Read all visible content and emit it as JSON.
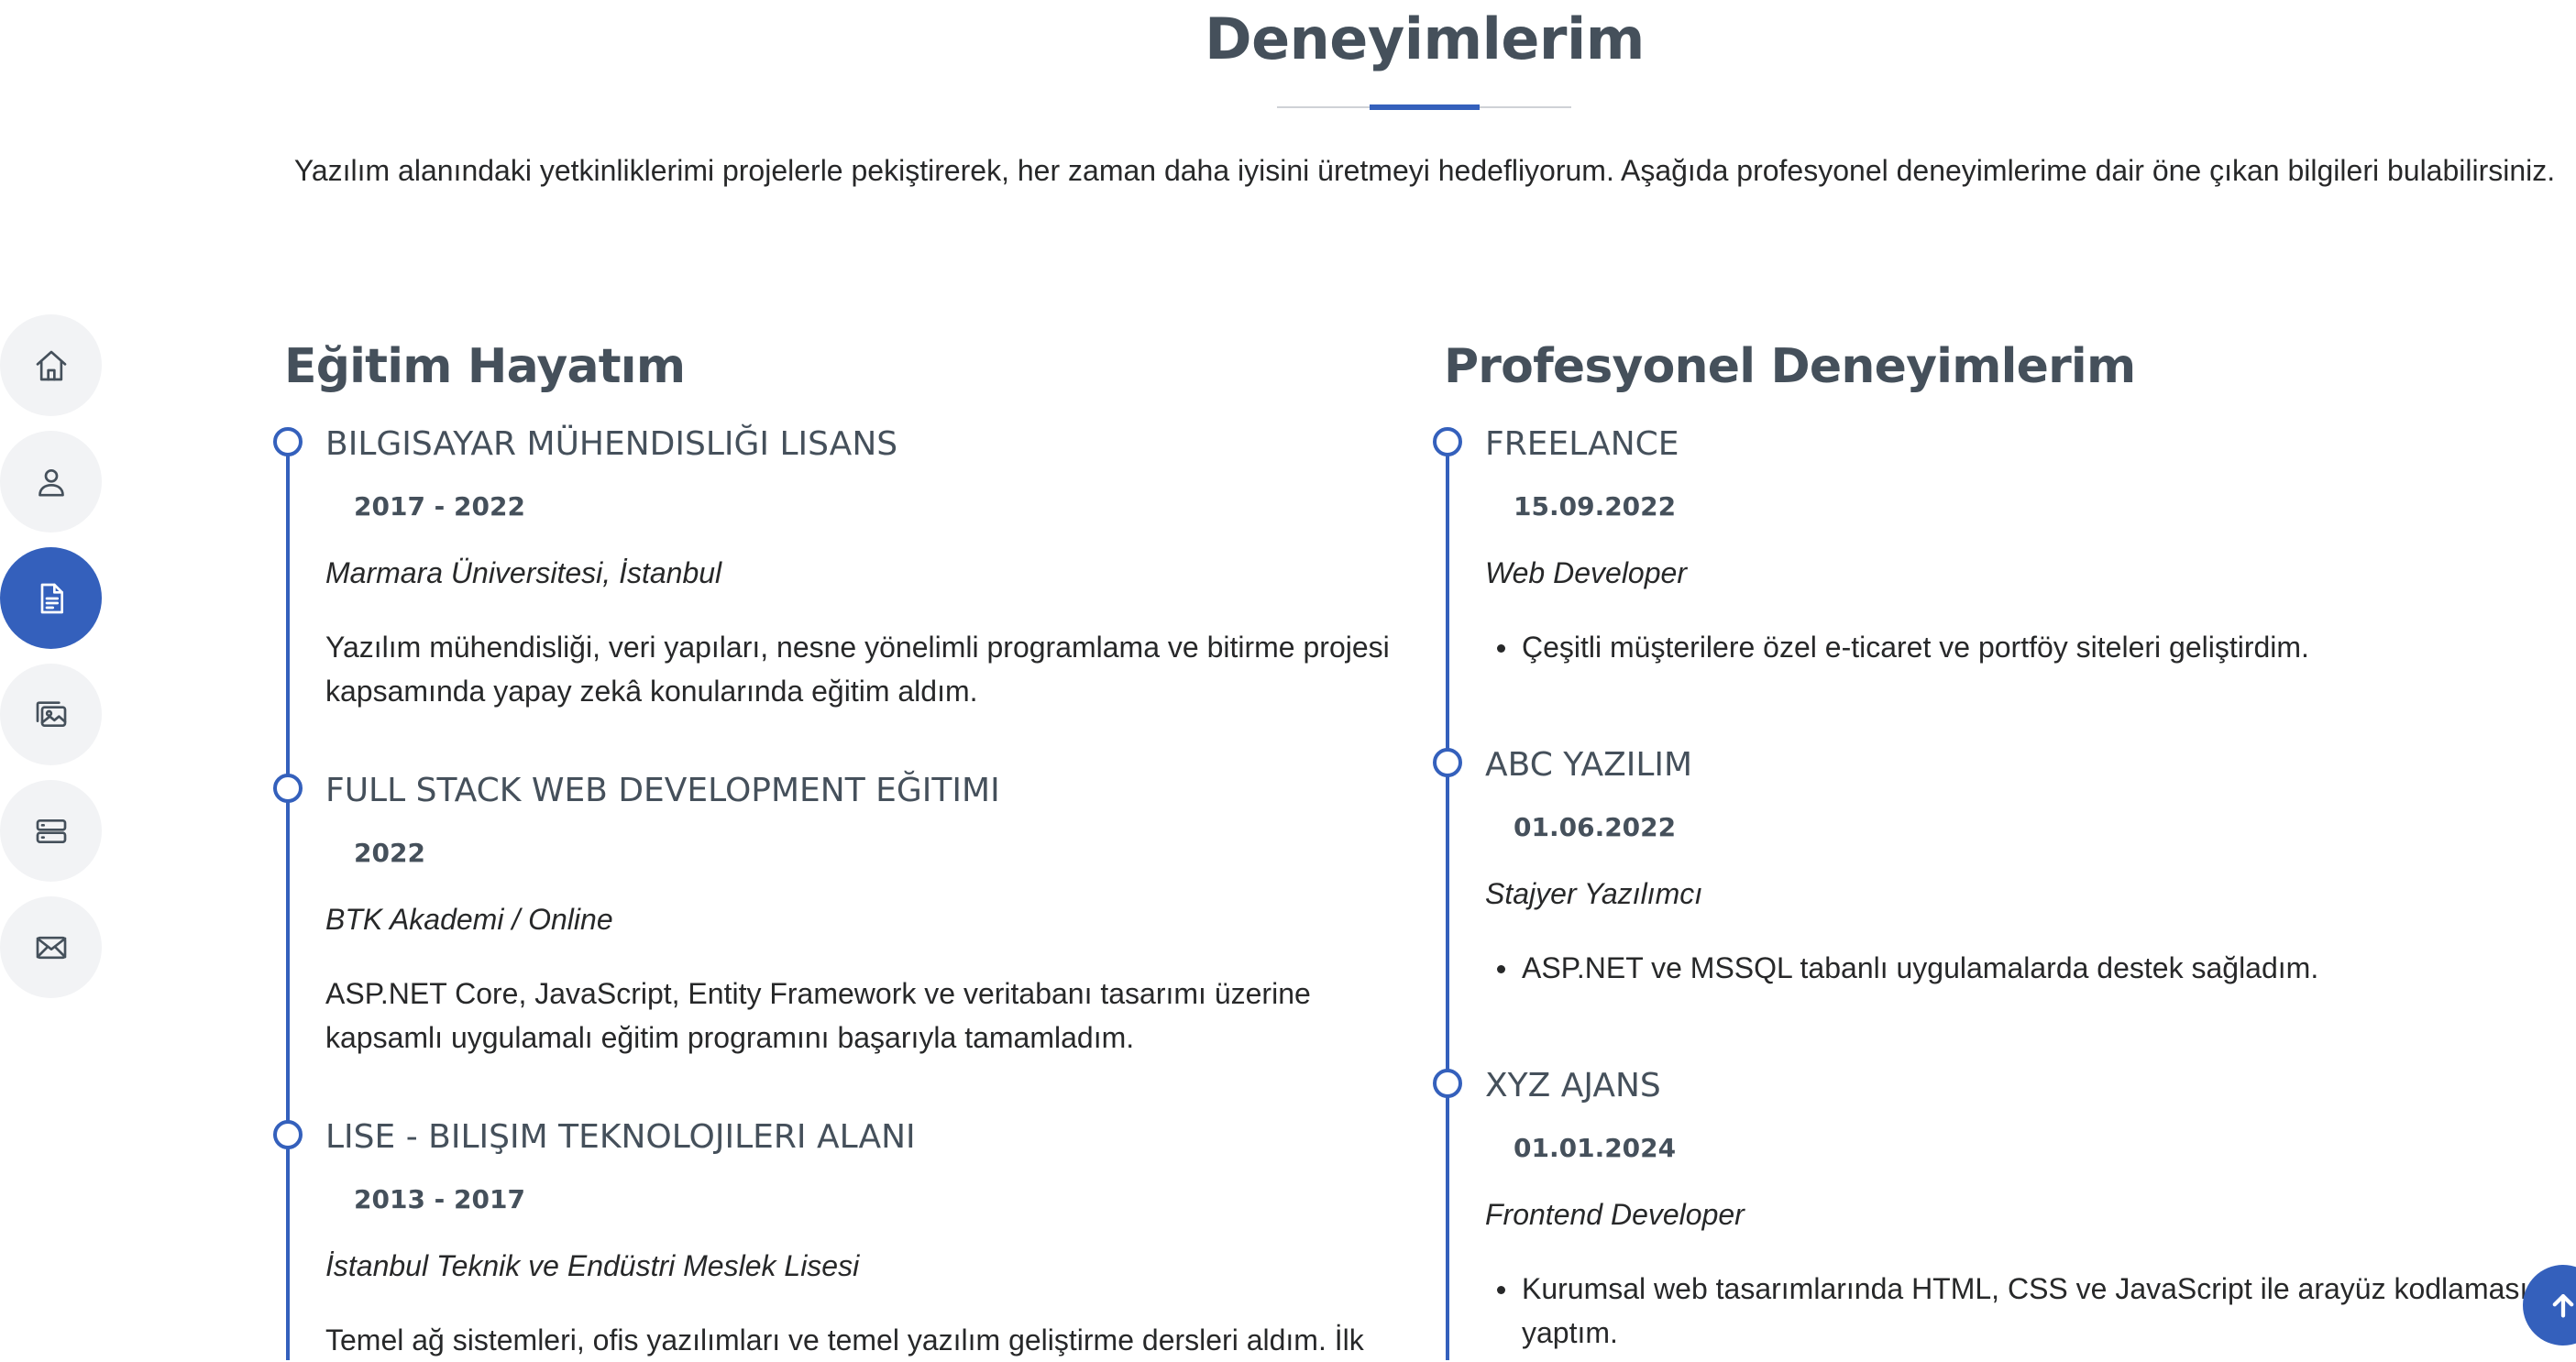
{
  "section": {
    "title": "Deneyimlerim",
    "description": "Yazılım alanındaki yetkinliklerimi projelerle pekiştirerek, her zaman daha iyisini üretmeyi hedefliyorum. Aşağıda profesyonel deneyimlerime dair öne çıkan bilgileri bulabilirsiniz."
  },
  "nav": {
    "items": [
      {
        "icon": "home-icon",
        "active": false
      },
      {
        "icon": "person-icon",
        "active": false
      },
      {
        "icon": "document-icon",
        "active": true
      },
      {
        "icon": "images-icon",
        "active": false
      },
      {
        "icon": "server-icon",
        "active": false
      },
      {
        "icon": "envelope-icon",
        "active": false
      }
    ]
  },
  "education": {
    "title": "Eğitim Hayatım",
    "items": [
      {
        "title": "Bilgisayar Mühendisliği Lisans",
        "date": "2017 - 2022",
        "place": "Marmara Üniversitesi, İstanbul",
        "text_line1": "Yazılım mühendisliği, veri yapıları, nesne yönelimli programlama ve bitirme projesi",
        "text_line2": "kapsamında yapay zekâ konularında eğitim aldım."
      },
      {
        "title": "Full Stack Web Development Eğitimi",
        "date": "2022",
        "place": "BTK Akademi / Online",
        "text_line1": "ASP.NET Core, JavaScript, Entity Framework ve veritabanı tasarımı üzerine",
        "text_line2": "kapsamlı uygulamalı eğitim programını başarıyla tamamladım."
      },
      {
        "title": "Lise - Bilişim Teknolojileri Alanı",
        "date": "2013 - 2017",
        "place": "İstanbul Teknik ve Endüstri Meslek Lisesi",
        "text_line1": "Temel ağ sistemleri, ofis yazılımları ve temel yazılım geliştirme dersleri aldım. İlk"
      }
    ]
  },
  "experience": {
    "title": "Profesyonel Deneyimlerim",
    "items": [
      {
        "title": "Freelance",
        "date": "15.09.2022",
        "role": "Web Developer",
        "bullet_line1": "Çeşitli müşterilere özel e-ticaret ve portföy siteleri geliştirdim."
      },
      {
        "title": "ABC Yazılım",
        "date": "01.06.2022",
        "role": "Stajyer Yazılımcı",
        "bullet_line1": "ASP.NET ve MSSQL tabanlı uygulamalarda destek sağladım."
      },
      {
        "title": "XYZ Ajans",
        "date": "01.01.2024",
        "role": "Frontend Developer",
        "bullet_line1": "Kurumsal web tasarımlarında HTML, CSS ve JavaScript ile arayüz kodlaması",
        "bullet_line2": "yaptım."
      }
    ]
  },
  "colors": {
    "accent": "#3460bc",
    "heading": "#45505b",
    "text": "#272829",
    "nav_bg": "#f2f3f5"
  }
}
